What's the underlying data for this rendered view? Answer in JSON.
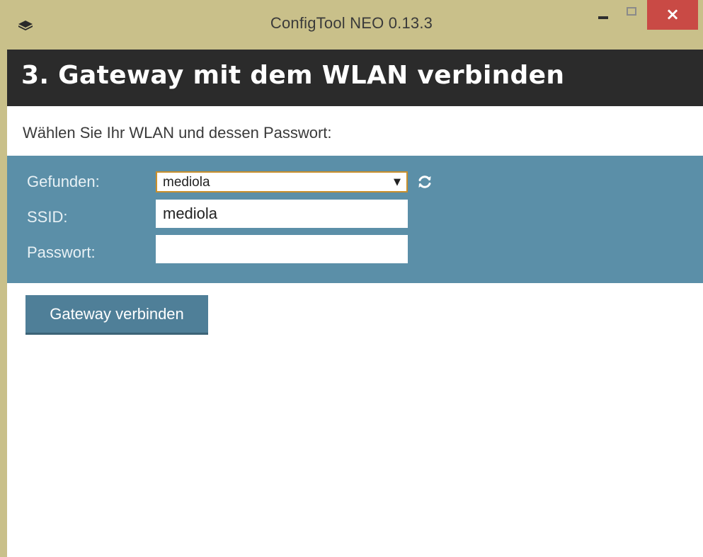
{
  "window": {
    "title": "ConfigTool NEO 0.13.3",
    "controls": {
      "minimize": "minimize-icon",
      "maximize": "maximize-icon",
      "close": "close-icon"
    }
  },
  "page": {
    "heading": "3. Gateway mit dem WLAN verbinden",
    "instruction": "Wählen Sie Ihr WLAN und dessen Passwort:"
  },
  "form": {
    "found_label": "Gefunden:",
    "found_selected": "mediola",
    "ssid_label": "SSID:",
    "ssid_value": "mediola",
    "password_label": "Passwort:",
    "password_value": ""
  },
  "actions": {
    "connect_label": "Gateway verbinden"
  },
  "icons": {
    "app": "app-logo-icon",
    "refresh": "refresh-icon",
    "dropdown": "chevron-down-icon"
  },
  "colors": {
    "title_bar": "#c9c08a",
    "header_band": "#2b2b2b",
    "form_band": "#5b8fa8",
    "button": "#4f7f98",
    "close_button": "#c94a45",
    "select_border": "#c98f2c"
  }
}
